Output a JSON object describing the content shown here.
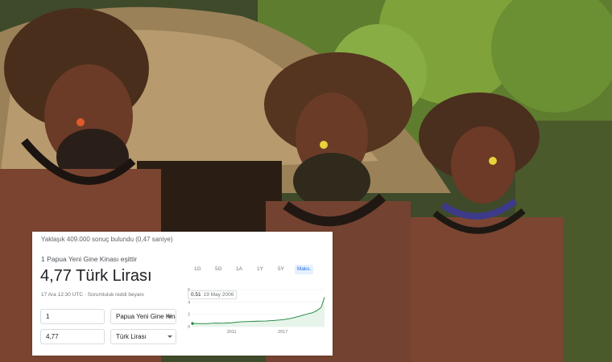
{
  "converter": {
    "result_stats": "Yaklaşık 409.000 sonuç bulundu (0,47 saniye)",
    "equals_line": "1 Papua Yeni Gine Kinası eşittir",
    "result_value": "4,77 Türk Lirası",
    "update_line": "17 Ara 12:30 UTC · Sorumluluk reddi beyanı",
    "inputs": [
      {
        "amount": "1",
        "unit": "Papua Yeni Gine Kinası"
      },
      {
        "amount": "4,77",
        "unit": "Türk Lirası"
      }
    ],
    "range_tabs": [
      "1G",
      "5G",
      "1A",
      "1Y",
      "5Y",
      "Maks."
    ],
    "active_tab": "Maks.",
    "tooltip": {
      "value": "0.51",
      "date": "19 May 2006"
    }
  },
  "chart_data": {
    "type": "area",
    "x_tick_labels": [
      "2011",
      "2017"
    ],
    "y_tick_labels": [
      "6",
      "4",
      "2",
      "0"
    ],
    "ylim": [
      0,
      6
    ],
    "series": [
      {
        "x": [
          2006.4,
          2007,
          2008,
          2009,
          2010,
          2011,
          2012,
          2013,
          2014,
          2015,
          2016,
          2017,
          2018,
          2019,
          2020,
          2020.5,
          2021,
          2021.5,
          2021.9
        ],
        "values": [
          0.51,
          0.5,
          0.48,
          0.56,
          0.55,
          0.62,
          0.78,
          0.82,
          0.88,
          0.9,
          1.0,
          1.12,
          1.35,
          1.7,
          2.1,
          2.25,
          2.6,
          3.1,
          4.77
        ]
      }
    ],
    "line_color": "#188038",
    "fill_color": "#e6f4ea"
  }
}
